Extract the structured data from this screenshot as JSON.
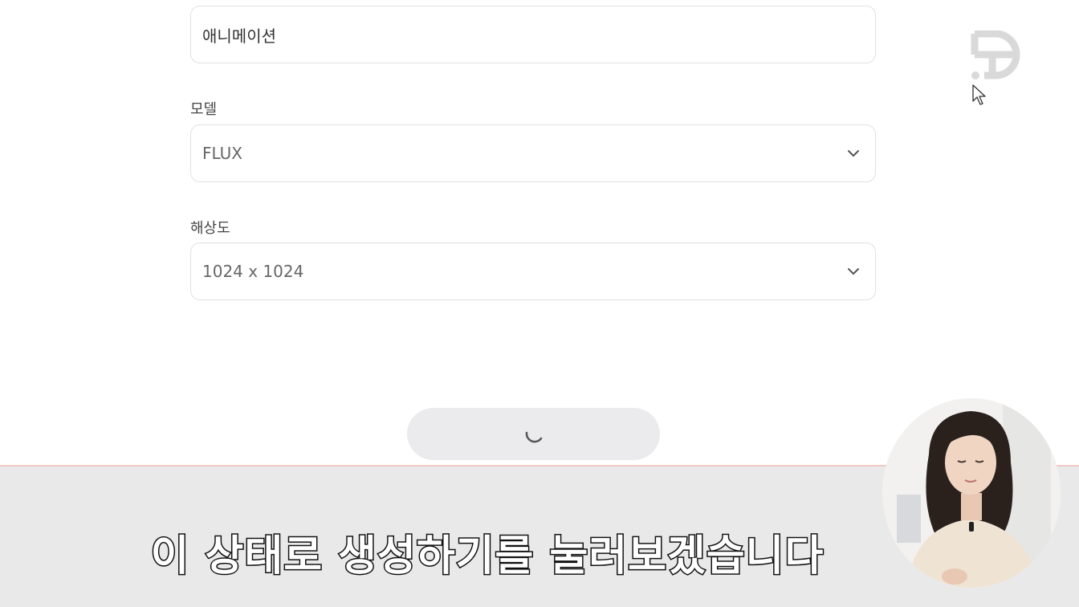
{
  "form": {
    "style_value": "애니메이션",
    "model_label": "모델",
    "model_value": "FLUX",
    "resolution_label": "해상도",
    "resolution_value": "1024 x 1024"
  },
  "generate_button": {
    "state": "loading",
    "icon": "spinner-icon"
  },
  "branding": {
    "logo_icon": "channel-logo-icon",
    "logo_color": "#d9d9d9"
  },
  "subtitle": {
    "text": "이 상태로 생성하기를 눌러보겠습니다"
  },
  "colors": {
    "field_border": "#e1e1e1",
    "button_bg": "#ebebee",
    "subtitle_bg": "#e9e9e9",
    "subtitle_accent_line": "#f1c9c6"
  }
}
